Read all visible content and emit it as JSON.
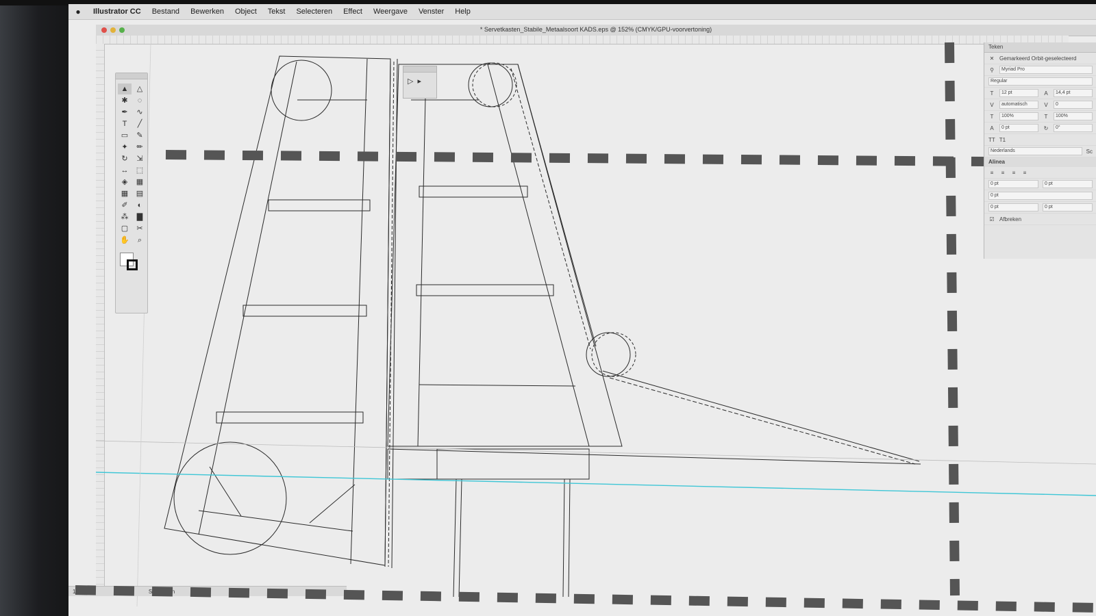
{
  "menubar": {
    "apple": "",
    "items": [
      "Illustrator CC",
      "Bestand",
      "Bewerken",
      "Object",
      "Tekst",
      "Selecteren",
      "Effect",
      "Weergave",
      "Venster",
      "Help"
    ]
  },
  "document": {
    "title": "* Servetkasten_Stabile_Metaalsoort KADS.eps @ 152% (CMYK/GPU-voorvertoning)"
  },
  "toolbox": {
    "tools": [
      "select",
      "direct-select",
      "magic-wand",
      "lasso",
      "pen",
      "curvature",
      "type",
      "line",
      "rectangle",
      "paintbrush",
      "shaper",
      "pencil",
      "rotate",
      "scale",
      "width",
      "free-transform",
      "shape-builder",
      "perspective",
      "mesh",
      "gradient",
      "eyedropper",
      "blend",
      "symbol-sprayer",
      "graph",
      "artboard",
      "slice",
      "hand",
      "zoom"
    ]
  },
  "mini_panel": {
    "tools": [
      "select",
      "direct-select"
    ]
  },
  "right_panel": {
    "header": "Teken",
    "rows": [
      {
        "label": "Gemarkeerd Orbit-geselecteerd"
      },
      {
        "label": "Myriad Pro"
      },
      {
        "label": "Regular"
      },
      {
        "field_a": "12 pt",
        "field_b": "14,4 pt"
      },
      {
        "field_a": "automatisch",
        "field_b": "0"
      },
      {
        "field_a": "100%",
        "field_b": "100%"
      },
      {
        "field_a": "0 pt",
        "field_b": "0°"
      },
      {
        "field_a": "TT",
        "field_b": "T1"
      },
      {
        "field_a": "Nederlands",
        "field_b": "Sc"
      }
    ],
    "section": "Alinea",
    "para_rows": [
      {
        "field_a": "0 pt",
        "field_b": "0 pt"
      },
      {
        "field_a": "0 pt",
        "field_b": ""
      },
      {
        "field_a": "0 pt",
        "field_b": "0 pt"
      }
    ],
    "footer": "Afbreken"
  },
  "statusbar": {
    "zoom": "152%",
    "page": "1",
    "mode": "Selecteren"
  },
  "colors": {
    "guide": "#3ec6d6",
    "art_stroke": "#2a2a2a",
    "overlay_dash": "#555555"
  }
}
